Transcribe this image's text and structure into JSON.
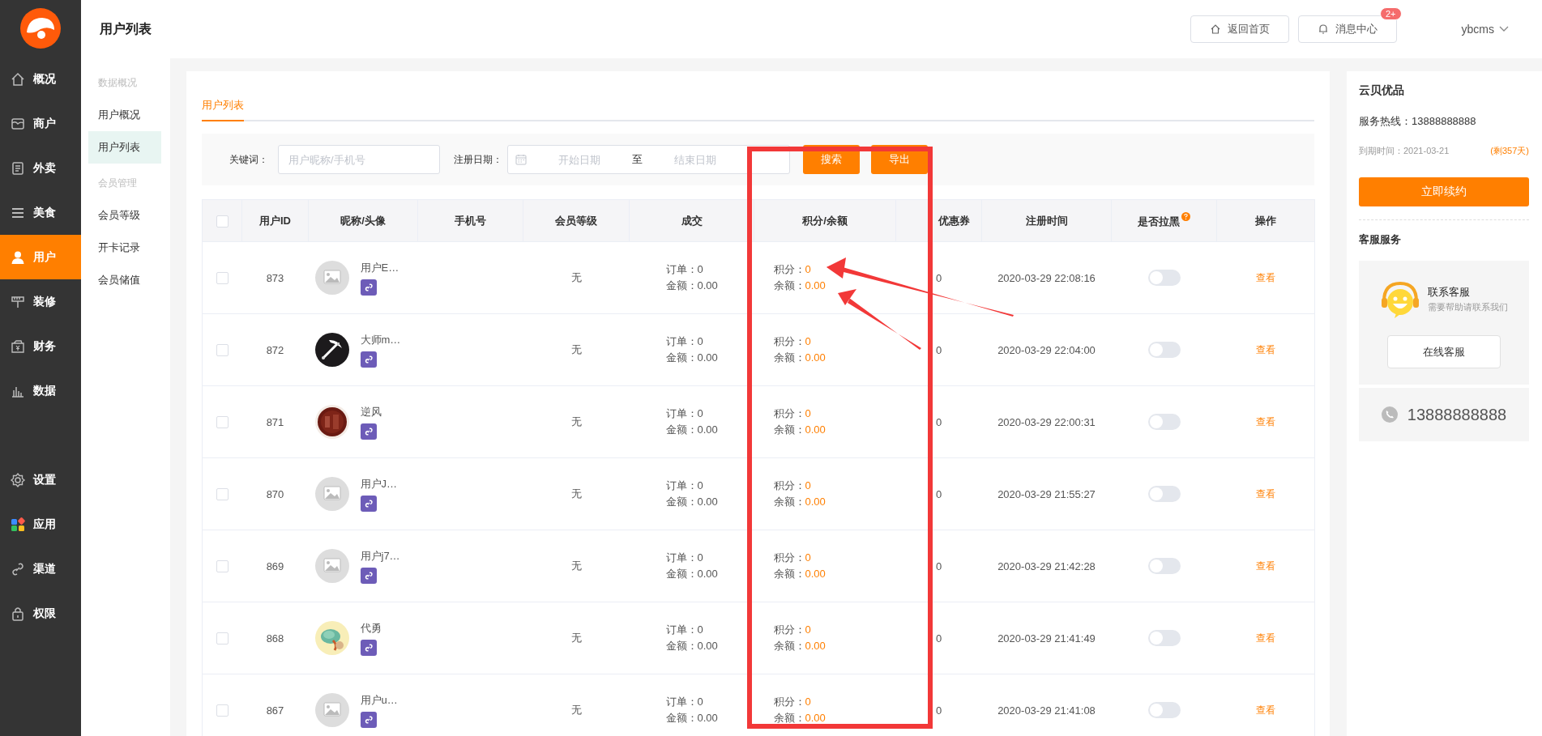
{
  "sidebar": {
    "main": [
      {
        "label": "概况",
        "selected": false
      },
      {
        "label": "商户",
        "selected": false
      },
      {
        "label": "外卖",
        "selected": false
      },
      {
        "label": "美食",
        "selected": false
      },
      {
        "label": "用户",
        "selected": true
      },
      {
        "label": "装修",
        "selected": false
      },
      {
        "label": "财务",
        "selected": false
      },
      {
        "label": "数据",
        "selected": false
      }
    ],
    "bottom": [
      {
        "label": "设置",
        "selected": false
      },
      {
        "label": "应用",
        "selected": false
      },
      {
        "label": "渠道",
        "selected": false
      },
      {
        "label": "权限",
        "selected": false
      }
    ]
  },
  "header": {
    "title": "用户列表",
    "buttons": [
      {
        "label": "返回首页"
      },
      {
        "label": "消息中心",
        "badge": "2+"
      }
    ],
    "user": "ybcms"
  },
  "subnav": {
    "groups": [
      {
        "title": "数据概况",
        "items": [
          {
            "label": "用户概况",
            "selected": false
          },
          {
            "label": "用户列表",
            "selected": true
          }
        ]
      },
      {
        "title": "会员管理",
        "items": [
          {
            "label": "会员等级",
            "selected": false
          },
          {
            "label": "开卡记录",
            "selected": false
          },
          {
            "label": "会员储值",
            "selected": false
          }
        ]
      }
    ]
  },
  "tabs": [
    {
      "label": "用户列表",
      "selected": true
    }
  ],
  "filters": {
    "keyword_label": "关键词：",
    "keyword": {
      "placeholder": "用户昵称/手机号"
    },
    "date_label": "注册日期：",
    "start_date": {
      "placeholder": "开始日期"
    },
    "separator": "至",
    "end_date": {
      "placeholder": "结束日期"
    },
    "buttons": [
      "搜索",
      "导出"
    ]
  },
  "table": {
    "select_all": {
      "checked": false
    },
    "columns": [
      "用户ID",
      "昵称/头像",
      "手机号",
      "会员等级",
      "成交",
      "积分/余额",
      "优惠券",
      "注册时间",
      "是否拉黑",
      "操作"
    ],
    "rows": [
      {
        "checked": false,
        "id": "873",
        "avatar": {
          "kind": "placeholder"
        },
        "nickname": "用户E…",
        "level": "无",
        "orders": "订单：0",
        "amount": "金额：0.00",
        "points_label": "积分：",
        "points": "0",
        "balance_label": "余额：",
        "balance": "0.00",
        "coupons": "0",
        "registered": "2020-03-29 22:08:16",
        "blacklisted": false,
        "action": "查看"
      },
      {
        "checked": false,
        "id": "872",
        "nickname": "大师m…",
        "level": "无",
        "orders": "订单：0",
        "amount": "金额：0.00",
        "points_label": "积分：",
        "points": "0",
        "balance_label": "余额：",
        "balance": "0.00",
        "coupons": "0",
        "registered": "2020-03-29 22:04:00",
        "blacklisted": false,
        "action": "查看"
      },
      {
        "checked": false,
        "id": "871",
        "nickname": "逆风",
        "level": "无",
        "orders": "订单：0",
        "amount": "金额：0.00",
        "points_label": "积分：",
        "points": "0",
        "balance_label": "余额：",
        "balance": "0.00",
        "coupons": "0",
        "registered": "2020-03-29 22:00:31",
        "blacklisted": false,
        "action": "查看"
      },
      {
        "checked": false,
        "id": "870",
        "avatar": {
          "kind": "placeholder"
        },
        "nickname": "用户J…",
        "level": "无",
        "orders": "订单：0",
        "amount": "金额：0.00",
        "points_label": "积分：",
        "points": "0",
        "balance_label": "余额：",
        "balance": "0.00",
        "coupons": "0",
        "registered": "2020-03-29 21:55:27",
        "blacklisted": false,
        "action": "查看"
      },
      {
        "checked": false,
        "id": "869",
        "avatar": {
          "kind": "placeholder"
        },
        "nickname": "用户j7…",
        "level": "无",
        "orders": "订单：0",
        "amount": "金额：0.00",
        "points_label": "积分：",
        "points": "0",
        "balance_label": "余额：",
        "balance": "0.00",
        "coupons": "0",
        "registered": "2020-03-29 21:42:28",
        "blacklisted": false,
        "action": "查看"
      },
      {
        "checked": false,
        "id": "868",
        "nickname": "代勇",
        "level": "无",
        "orders": "订单：0",
        "amount": "金额：0.00",
        "points_label": "积分：",
        "points": "0",
        "balance_label": "余额：",
        "balance": "0.00",
        "coupons": "0",
        "registered": "2020-03-29 21:41:49",
        "blacklisted": false,
        "action": "查看"
      },
      {
        "checked": false,
        "id": "867",
        "avatar": {
          "kind": "placeholder"
        },
        "nickname": "用户u…",
        "level": "无",
        "orders": "订单：0",
        "amount": "金额：0.00",
        "points_label": "积分：",
        "points": "0",
        "balance_label": "余额：",
        "balance": "0.00",
        "coupons": "0",
        "registered": "2020-03-29 21:41:08",
        "blacklisted": false,
        "action": "查看"
      }
    ]
  },
  "right_panel": {
    "shop": "云贝优品",
    "hotline": "服务热线：13888888888",
    "expiry": "到期时间：2021-03-21",
    "remaining": "(剩357天)",
    "renew": "立即续约",
    "service_title": "客服服务",
    "contact_title": "联系客服",
    "contact_subtitle": "需要帮助请联系我们",
    "online_button": "在线客服",
    "phone": "13888888888"
  }
}
